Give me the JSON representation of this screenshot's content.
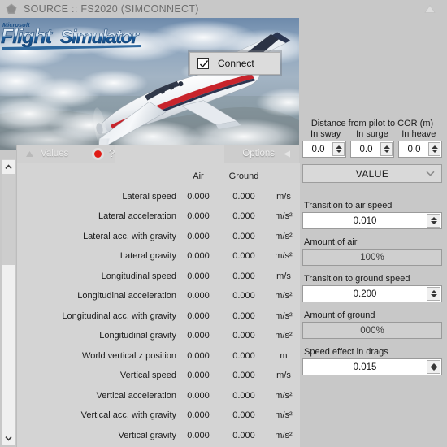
{
  "window": {
    "source_icon": "pentagon-icon",
    "source_title": "SOURCE :: FS2020 (SIMCONNECT)",
    "collapse_icon": "triangle-up-icon"
  },
  "hero": {
    "logo_text": "Microsoft Flight Simulator",
    "logo_small": "Microsoft",
    "logo_main": "Flight Simulator",
    "connect": {
      "label": "Connect",
      "checked": true,
      "check_icon": "checkmark-icon"
    }
  },
  "values_panel": {
    "tab_label": "Values",
    "collapse_icon": "triangle-up-icon",
    "record_indicator": "record-dot",
    "record_color": "#e01b15",
    "help_label": "?",
    "options_label": "Options",
    "options_icon": "triangle-left-icon",
    "columns": [
      "",
      "Air",
      "Ground",
      ""
    ],
    "rows": [
      {
        "name": "Lateral speed",
        "air": "0.000",
        "ground": "0.000",
        "unit": "m/s"
      },
      {
        "name": "Lateral acceleration",
        "air": "0.000",
        "ground": "0.000",
        "unit": "m/s²"
      },
      {
        "name": "Lateral acc. with gravity",
        "air": "0.000",
        "ground": "0.000",
        "unit": "m/s²"
      },
      {
        "name": "Lateral gravity",
        "air": "0.000",
        "ground": "0.000",
        "unit": "m/s²"
      },
      {
        "name": "Longitudinal speed",
        "air": "0.000",
        "ground": "0.000",
        "unit": "m/s"
      },
      {
        "name": "Longitudinal acceleration",
        "air": "0.000",
        "ground": "0.000",
        "unit": "m/s²"
      },
      {
        "name": "Longitudinal acc. with gravity",
        "air": "0.000",
        "ground": "0.000",
        "unit": "m/s²"
      },
      {
        "name": "Longitudinal gravity",
        "air": "0.000",
        "ground": "0.000",
        "unit": "m/s²"
      },
      {
        "name": "World vertical z position",
        "air": "0.000",
        "ground": "0.000",
        "unit": "m"
      },
      {
        "name": "Vertical speed",
        "air": "0.000",
        "ground": "0.000",
        "unit": "m/s"
      },
      {
        "name": "Vertical acceleration",
        "air": "0.000",
        "ground": "0.000",
        "unit": "m/s²"
      },
      {
        "name": "Vertical acc. with gravity",
        "air": "0.000",
        "ground": "0.000",
        "unit": "m/s²"
      },
      {
        "name": "Vertical gravity",
        "air": "0.000",
        "ground": "0.000",
        "unit": "m/s²"
      }
    ]
  },
  "scrollbar": {
    "up_icon": "chevron-up-icon",
    "down_icon": "chevron-down-icon",
    "thumb": "scroll-thumb"
  },
  "options": {
    "distance_title": "Distance from pilot to COR (m)",
    "sway_label": "In sway",
    "surge_label": "In surge",
    "heave_label": "In heave",
    "sway_value": "0.0",
    "surge_value": "0.0",
    "heave_value": "0.0",
    "mode_select": {
      "selected": "VALUE",
      "chevron": "chevron-down-icon"
    },
    "transition_air_label": "Transition to air speed",
    "transition_air_value": "0.010",
    "amount_air_label": "Amount of air",
    "amount_air_value": "100%",
    "transition_ground_label": "Transition to ground speed",
    "transition_ground_value": "0.200",
    "amount_ground_label": "Amount of ground",
    "amount_ground_value": "000%",
    "speed_drags_label": "Speed effect in drags",
    "speed_drags_value": "0.015"
  }
}
